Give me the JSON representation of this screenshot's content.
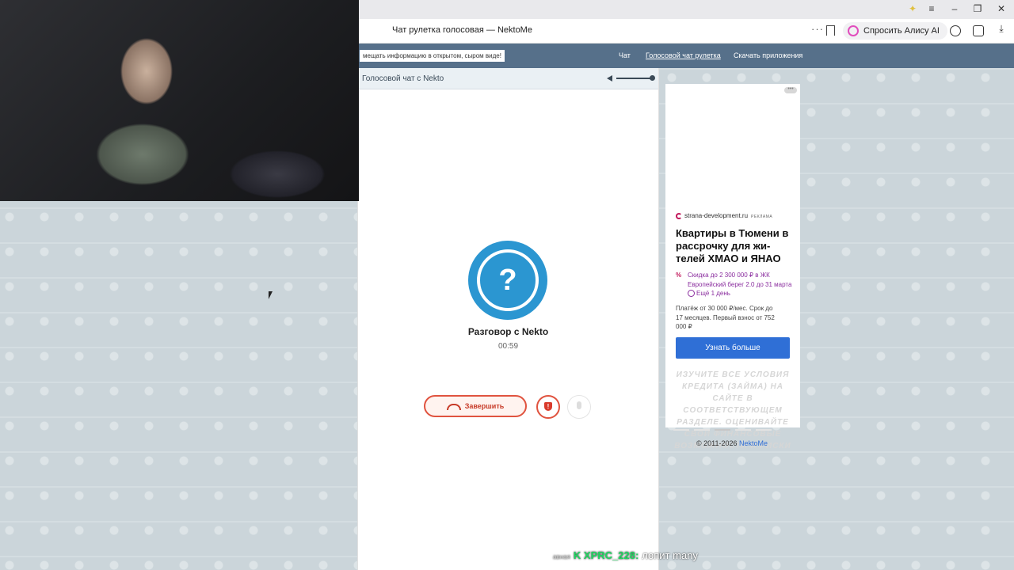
{
  "browser": {
    "tab_title": "Чат рулетка голосовая — NektoMe",
    "alice_button": "Спросить Алису AI"
  },
  "site": {
    "notice": "мещать информацию в открытом, сыром виде!",
    "nav": [
      {
        "label": "Чат",
        "active": false
      },
      {
        "label": "Голосовой чат рулетка",
        "active": true
      },
      {
        "label": "Скачать приложения",
        "active": false
      }
    ]
  },
  "chat": {
    "header_title": "Голосовой чат с Nekto",
    "volume_level": 1.0,
    "avatar_glyph": "?",
    "peer_name": "Разговор с Nekto",
    "timer": "00:59",
    "end_button": "Завершить",
    "report_glyph": "!"
  },
  "ad": {
    "more_glyph": "•••",
    "source": "strana-development.ru",
    "source_tag": "РЕКЛАМА",
    "title": "Квартиры в Тюмени в рассрочку для жи-телей ХМАО и ЯНАО",
    "discount_symbol": "%",
    "discount": "Скидка до 2 300 000 ₽ в ЖК Европейский берег 2.0 до 31 марта",
    "discount_days": "Ещё 1 день",
    "terms": "Платёж от 30 000 ₽/мес. Срок до 17 месяцев. Первый взнос от 752 000 ₽",
    "cta": "Узнать больше",
    "disclaimer": "ИЗУЧИТЕ ВСЕ УСЛОВИЯ КРЕДИТА (ЗАЙМА) НА САЙТЕ В СООТВЕТСТВУЮЩЕМ РАЗДЕЛЕ. ОЦЕНИВАЙТЕ СВОИ ФИНАНСОВЫЕ ВОЗМОЖНОСТИ И РИСКИ"
  },
  "footer": {
    "copyright": "© 2011-2026 ",
    "link": "NektoMe"
  },
  "stream_overlay": {
    "badge": "авная",
    "user": "K XPRC_228:",
    "message": "лопит many"
  },
  "colors": {
    "header_bg": "#56708a",
    "avatar": "#2b96d1",
    "end_call": "#e0533f",
    "cta": "#2f6fd6"
  }
}
